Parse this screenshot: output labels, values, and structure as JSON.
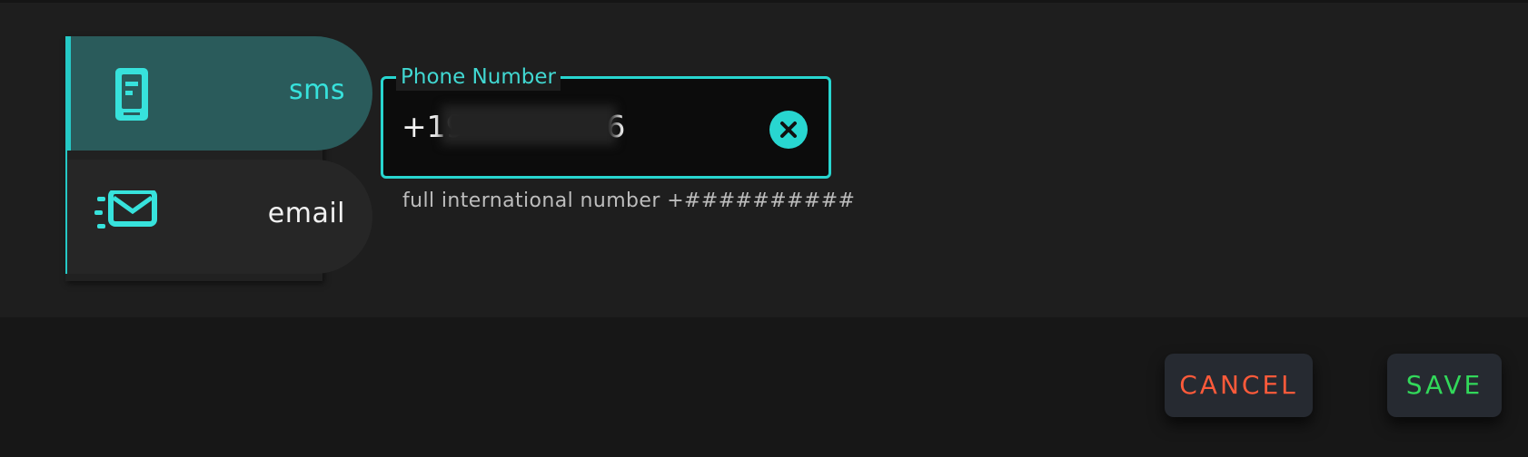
{
  "contact_method": {
    "selected": "sms",
    "items": [
      {
        "id": "sms",
        "label": "sms",
        "icon": "sms-phone-icon"
      },
      {
        "id": "email",
        "label": "email",
        "icon": "email-envelope-icon"
      }
    ]
  },
  "phone_number": {
    "label": "Phone Number",
    "value": "+19••••••••6",
    "helper_text": "full international number +##########",
    "clear_icon": "clear-x-icon"
  },
  "actions": {
    "cancel_label": "CANCEL",
    "save_label": "SAVE"
  },
  "colors": {
    "accent": "#28d6d0",
    "cancel": "#ff5a3a",
    "save": "#32d85a"
  }
}
